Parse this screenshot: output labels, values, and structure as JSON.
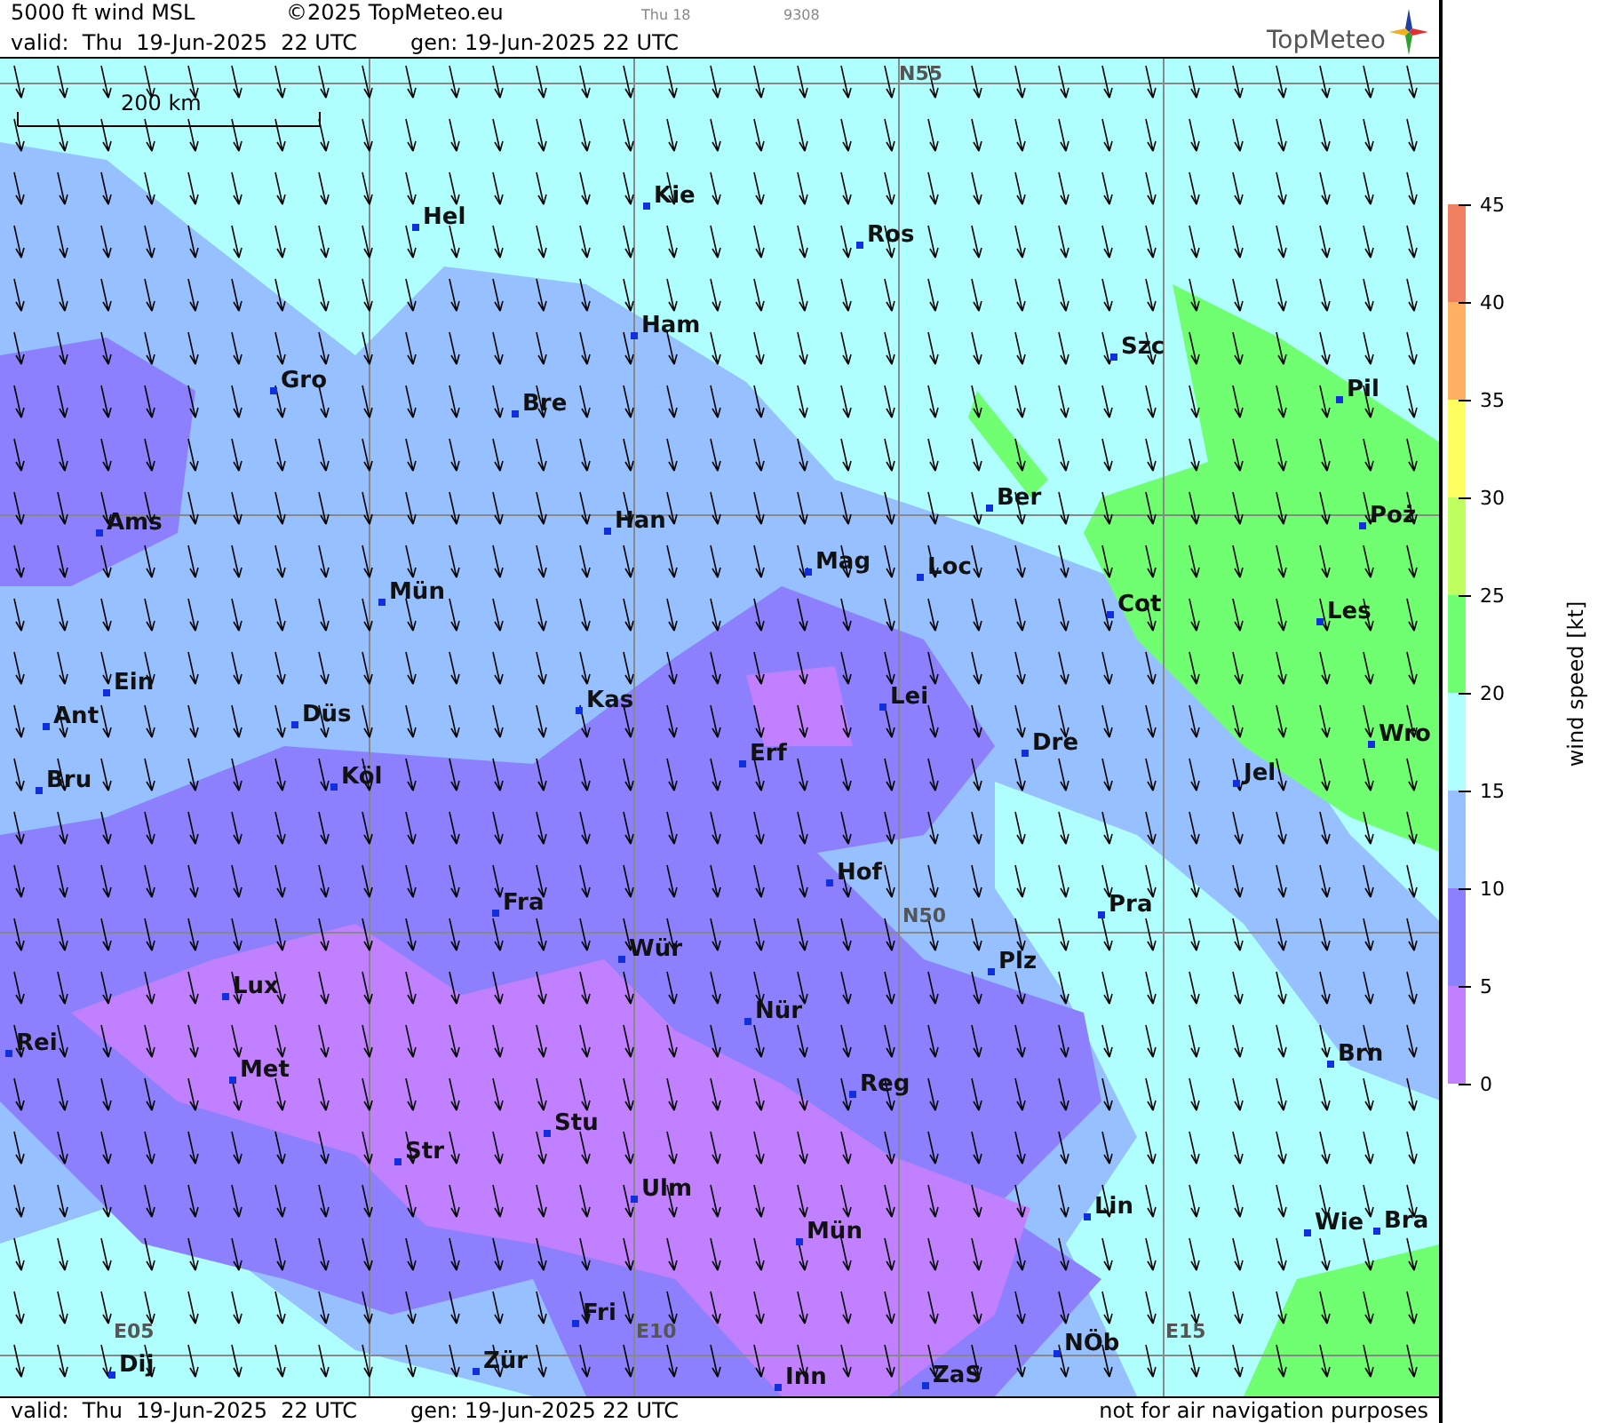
{
  "header": {
    "title": "5000 ft wind MSL",
    "copyright": "©2025 TopMeteo.eu",
    "run_label": "Thu 18",
    "code": "9308",
    "valid": "valid:  Thu  19-Jun-2025  22 UTC",
    "generated": "gen: 19-Jun-2025 22 UTC",
    "logo": "TopMeteo"
  },
  "map": {
    "scale_bar": "200 km",
    "grid_labels": [
      "N55",
      "N50",
      "E05",
      "E10",
      "E15"
    ],
    "cities": [
      "Hel",
      "Kie",
      "Ros",
      "Ham",
      "Szc",
      "Gro",
      "Bre",
      "Pil",
      "Ams",
      "Han",
      "Ber",
      "Poż",
      "Mag",
      "Loc",
      "Mün",
      "Cot",
      "Les",
      "Ein",
      "Kas",
      "Lei",
      "Ant",
      "Düs",
      "Erf",
      "Dre",
      "Wro",
      "Bru",
      "Köl",
      "Jel",
      "Hof",
      "Fra",
      "Pra",
      "Wür",
      "Plz",
      "Lux",
      "Nür",
      "Rei",
      "Met",
      "Brn",
      "Reg",
      "Stu",
      "Str",
      "Ulm",
      "Lin",
      "Mün",
      "Wie",
      "Bra",
      "Fri",
      "Dij",
      "Zür",
      "NÖb",
      "Inn",
      "ZaS"
    ]
  },
  "legend": {
    "title": "wind speed [kt]",
    "ticks": [
      "45",
      "40",
      "35",
      "30",
      "25",
      "20",
      "15",
      "10",
      "5",
      "0"
    ],
    "bands": [
      {
        "color": "#f08060"
      },
      {
        "color": "#ffb060"
      },
      {
        "color": "#ffff60"
      },
      {
        "color": "#c0ff60"
      },
      {
        "color": "#70ff70"
      },
      {
        "color": "#b0ffff"
      },
      {
        "color": "#96c0ff"
      },
      {
        "color": "#8c80ff"
      },
      {
        "color": "#c080ff"
      }
    ]
  },
  "footer": {
    "valid": "valid:  Thu  19-Jun-2025  22 UTC",
    "generated": "gen: 19-Jun-2025 22 UTC",
    "note": "not for air navigation purposes"
  }
}
